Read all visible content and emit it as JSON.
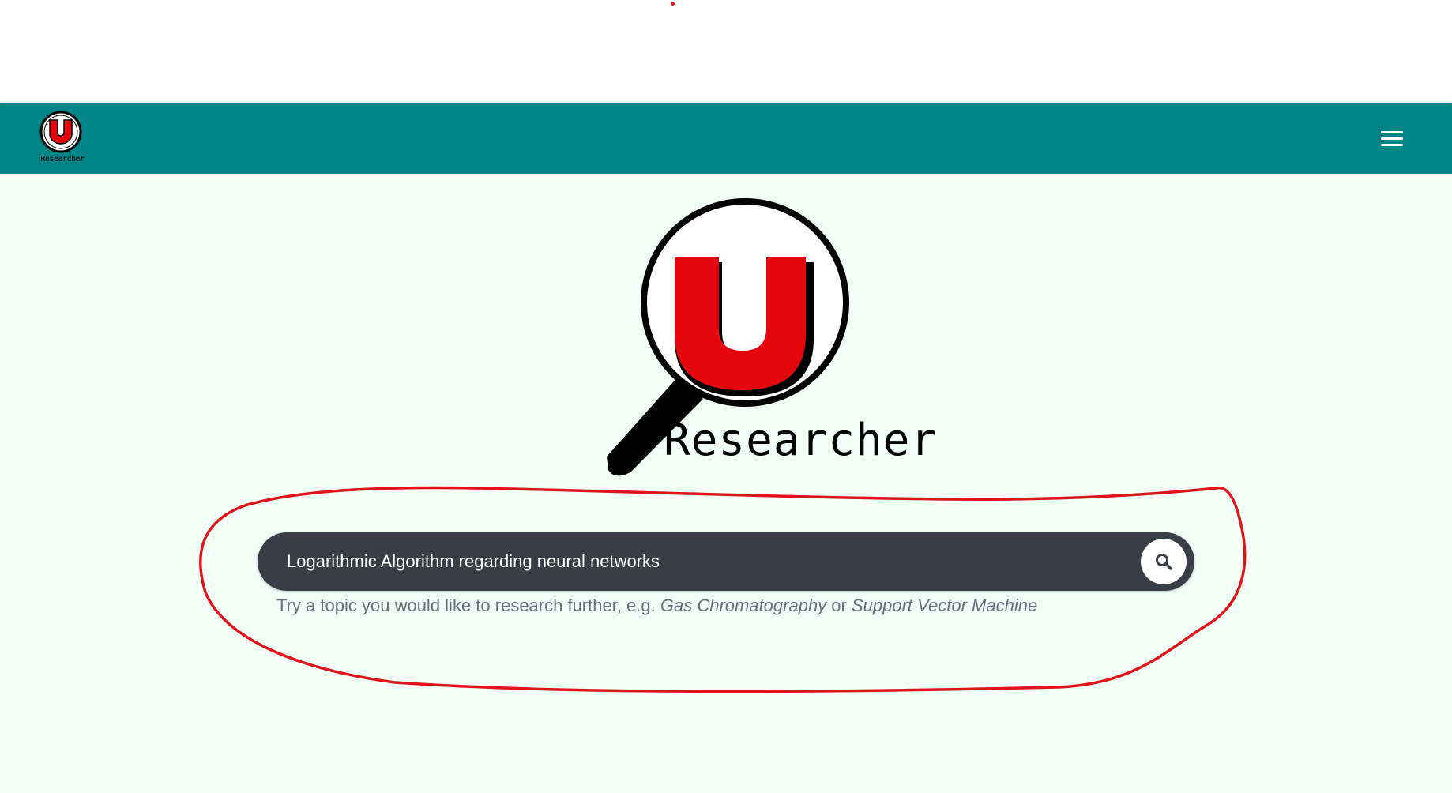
{
  "brand": {
    "mark_letter": "U",
    "wordmark": "Researcher"
  },
  "navbar": {
    "menu_icon": "hamburger-menu-icon"
  },
  "hero": {
    "mark_letter": "U",
    "wordmark": "Researcher"
  },
  "search": {
    "value": "Logarithmic Algorithm regarding neural networks",
    "button_icon": "search-icon"
  },
  "hint": {
    "prefix": "Try a topic you would like to research further, e.g. ",
    "example_1": "Gas Chromatography",
    "connector": " or ",
    "example_2": "Support Vector Machine"
  },
  "colors": {
    "navbar": "#008486",
    "background": "#f2fdf8",
    "search_bar": "#393d45",
    "brand_red": "#e5060d",
    "annotation_red": "#e0141b"
  }
}
